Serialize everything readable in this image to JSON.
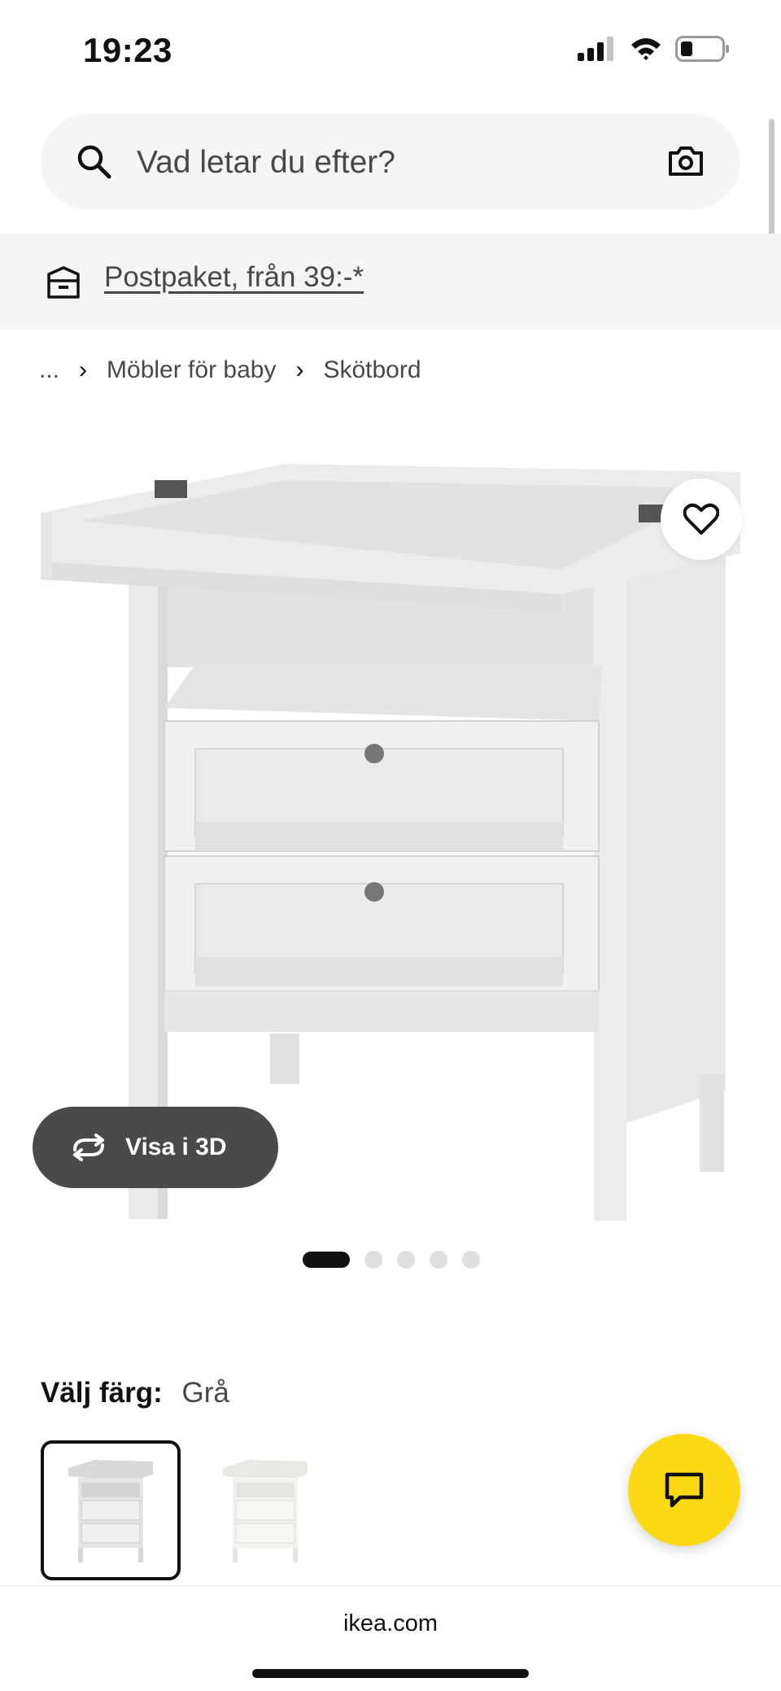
{
  "status_bar": {
    "time": "19:23",
    "icons": [
      "cellular-signal-icon",
      "wifi-icon",
      "battery-icon"
    ]
  },
  "search": {
    "placeholder": "Vad letar du efter?",
    "icons": [
      "search-icon",
      "camera-icon"
    ]
  },
  "promo": {
    "icon": "delivery-box-icon",
    "text": "Postpaket, från 39:-*"
  },
  "breadcrumb": {
    "ellipsis": "...",
    "items": [
      "Möbler för baby",
      "Skötbord"
    ]
  },
  "product": {
    "image_icon": "changing-table-image",
    "favorite_icon": "heart-icon",
    "view3d_label": "Visa i 3D",
    "carousel": {
      "total": 5,
      "active": 1
    }
  },
  "color_picker": {
    "label": "Välj färg:",
    "value": "Grå",
    "swatches": [
      {
        "name": "Grå",
        "selected": true,
        "color": "#e4e4e4"
      },
      {
        "name": "Vit",
        "selected": false,
        "color": "#f3f2ee"
      }
    ]
  },
  "chat": {
    "icon": "chat-bubble-icon",
    "color": "#fbd914"
  },
  "browser": {
    "url": "ikea.com"
  }
}
